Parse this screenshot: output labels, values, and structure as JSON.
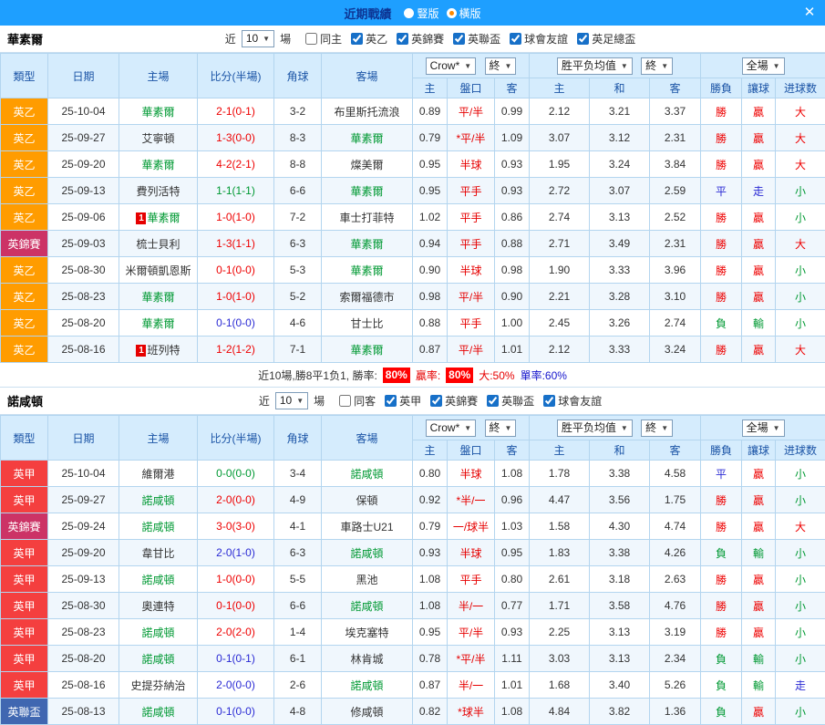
{
  "titlebar": {
    "title": "近期戰績",
    "radio_vertical": "豎版",
    "radio_horizontal": "橫版",
    "close_icon": "✕"
  },
  "table_header": {
    "type": "類型",
    "date": "日期",
    "home": "主場",
    "score": "比分(半場)",
    "corners": "角球",
    "away": "客場",
    "odds_source": "Crow*",
    "final": "終",
    "avg": "胜平负均值",
    "full_match": "全場",
    "home_odds": "主",
    "handicap": "盤口",
    "away_odds": "客",
    "avg_home": "主",
    "avg_draw": "和",
    "avg_away": "客",
    "win_loss": "勝負",
    "give_ball": "讓球",
    "goals": "进球数"
  },
  "colors": {
    "titlebar_bg": "#1E9FFF",
    "league": {
      "英乙": "#FF9C00",
      "英甲": "#F43F3F",
      "英錦賽": "#CC3366",
      "英聯盃": "#4067B1"
    },
    "result": {
      "win": "#EE0000",
      "draw": "#009933",
      "loss": "#2A2AD4"
    },
    "outcome": {
      "勝": "#EE0000",
      "平": "#2A2AD4",
      "負": "#009933",
      "贏": "#EE0000",
      "走": "#2A2AD4",
      "輸": "#009933",
      "大": "#EE0000",
      "小": "#009933"
    },
    "focal_team": "#009933",
    "handicap_text": "#E60000"
  },
  "sections": [
    {
      "team": "華素爾",
      "near_label": "近",
      "count": "10",
      "games_label": "場",
      "filters": [
        {
          "label": "同主",
          "checked": false
        },
        {
          "label": "英乙",
          "checked": true
        },
        {
          "label": "英錦賽",
          "checked": true
        },
        {
          "label": "英聯盃",
          "checked": true
        },
        {
          "label": "球會友誼",
          "checked": true
        },
        {
          "label": "英足總盃",
          "checked": true
        }
      ],
      "rows": [
        {
          "league": "英乙",
          "date": "25-10-04",
          "home": "華素爾",
          "home_focal": true,
          "away": "布里斯托流浪",
          "away_focal": false,
          "score": "2-1(0-1)",
          "result": "win",
          "corners": "3-2",
          "odds_h": "0.89",
          "handicap": "平/半",
          "odds_a": "0.99",
          "avg_h": "2.12",
          "avg_d": "3.21",
          "avg_a": "3.37",
          "wl": "勝",
          "give": "贏",
          "goals": "大"
        },
        {
          "league": "英乙",
          "date": "25-09-27",
          "home": "艾寧頓",
          "home_focal": false,
          "away": "華素爾",
          "away_focal": true,
          "score": "1-3(0-0)",
          "result": "win",
          "corners": "8-3",
          "odds_h": "0.79",
          "handicap": "*平/半",
          "odds_a": "1.09",
          "avg_h": "3.07",
          "avg_d": "3.12",
          "avg_a": "2.31",
          "wl": "勝",
          "give": "贏",
          "goals": "大"
        },
        {
          "league": "英乙",
          "date": "25-09-20",
          "home": "華素爾",
          "home_focal": true,
          "away": "燦美爾",
          "away_focal": false,
          "score": "4-2(2-1)",
          "result": "win",
          "corners": "8-8",
          "odds_h": "0.95",
          "handicap": "半球",
          "odds_a": "0.93",
          "avg_h": "1.95",
          "avg_d": "3.24",
          "avg_a": "3.84",
          "wl": "勝",
          "give": "贏",
          "goals": "大"
        },
        {
          "league": "英乙",
          "date": "25-09-13",
          "home": "費列活特",
          "home_focal": false,
          "away": "華素爾",
          "away_focal": true,
          "score": "1-1(1-1)",
          "result": "draw",
          "corners": "6-6",
          "odds_h": "0.95",
          "handicap": "平手",
          "odds_a": "0.93",
          "avg_h": "2.72",
          "avg_d": "3.07",
          "avg_a": "2.59",
          "wl": "平",
          "give": "走",
          "goals": "小"
        },
        {
          "league": "英乙",
          "date": "25-09-06",
          "home": "華素爾",
          "home_focal": true,
          "home_badge": "1",
          "away": "車士打菲特",
          "away_focal": false,
          "score": "1-0(1-0)",
          "result": "win",
          "corners": "7-2",
          "odds_h": "1.02",
          "handicap": "平手",
          "odds_a": "0.86",
          "avg_h": "2.74",
          "avg_d": "3.13",
          "avg_a": "2.52",
          "wl": "勝",
          "give": "贏",
          "goals": "小"
        },
        {
          "league": "英錦賽",
          "date": "25-09-03",
          "home": "梳士貝利",
          "home_focal": false,
          "away": "華素爾",
          "away_focal": true,
          "score": "1-3(1-1)",
          "result": "win",
          "corners": "6-3",
          "odds_h": "0.94",
          "handicap": "平手",
          "odds_a": "0.88",
          "avg_h": "2.71",
          "avg_d": "3.49",
          "avg_a": "2.31",
          "wl": "勝",
          "give": "贏",
          "goals": "大"
        },
        {
          "league": "英乙",
          "date": "25-08-30",
          "home": "米爾頓凱恩斯",
          "home_focal": false,
          "away": "華素爾",
          "away_focal": true,
          "score": "0-1(0-0)",
          "result": "win",
          "corners": "5-3",
          "odds_h": "0.90",
          "handicap": "半球",
          "odds_a": "0.98",
          "avg_h": "1.90",
          "avg_d": "3.33",
          "avg_a": "3.96",
          "wl": "勝",
          "give": "贏",
          "goals": "小"
        },
        {
          "league": "英乙",
          "date": "25-08-23",
          "home": "華素爾",
          "home_focal": true,
          "away": "索爾福德市",
          "away_focal": false,
          "score": "1-0(1-0)",
          "result": "win",
          "corners": "5-2",
          "odds_h": "0.98",
          "handicap": "平/半",
          "odds_a": "0.90",
          "avg_h": "2.21",
          "avg_d": "3.28",
          "avg_a": "3.10",
          "wl": "勝",
          "give": "贏",
          "goals": "小"
        },
        {
          "league": "英乙",
          "date": "25-08-20",
          "home": "華素爾",
          "home_focal": true,
          "away": "甘士比",
          "away_focal": false,
          "score": "0-1(0-0)",
          "result": "loss",
          "corners": "4-6",
          "odds_h": "0.88",
          "handicap": "平手",
          "odds_a": "1.00",
          "avg_h": "2.45",
          "avg_d": "3.26",
          "avg_a": "2.74",
          "wl": "負",
          "give": "輸",
          "goals": "小"
        },
        {
          "league": "英乙",
          "date": "25-08-16",
          "home": "班列特",
          "home_focal": false,
          "home_badge": "1",
          "away": "華素爾",
          "away_focal": true,
          "score": "1-2(1-2)",
          "result": "win",
          "corners": "7-1",
          "odds_h": "0.87",
          "handicap": "平/半",
          "odds_a": "1.01",
          "avg_h": "2.12",
          "avg_d": "3.33",
          "avg_a": "3.24",
          "wl": "勝",
          "give": "贏",
          "goals": "大"
        }
      ],
      "summary": {
        "prefix": "近10場,勝8平1负1, 勝率:",
        "win_rate": "80%",
        "give_label": "贏率:",
        "give_rate": "80%",
        "big": "大:50%",
        "single": "單率:60%"
      }
    },
    {
      "team": "諾咸頓",
      "near_label": "近",
      "count": "10",
      "games_label": "場",
      "filters": [
        {
          "label": "同客",
          "checked": false
        },
        {
          "label": "英甲",
          "checked": true
        },
        {
          "label": "英錦賽",
          "checked": true
        },
        {
          "label": "英聯盃",
          "checked": true
        },
        {
          "label": "球會友誼",
          "checked": true
        }
      ],
      "rows": [
        {
          "league": "英甲",
          "date": "25-10-04",
          "home": "維爾港",
          "home_focal": false,
          "away": "諾咸頓",
          "away_focal": true,
          "score": "0-0(0-0)",
          "result": "draw",
          "corners": "3-4",
          "odds_h": "0.80",
          "handicap": "半球",
          "odds_a": "1.08",
          "avg_h": "1.78",
          "avg_d": "3.38",
          "avg_a": "4.58",
          "wl": "平",
          "give": "贏",
          "goals": "小"
        },
        {
          "league": "英甲",
          "date": "25-09-27",
          "home": "諾咸頓",
          "home_focal": true,
          "away": "保頓",
          "away_focal": false,
          "score": "2-0(0-0)",
          "result": "win",
          "corners": "4-9",
          "odds_h": "0.92",
          "handicap": "*半/一",
          "odds_a": "0.96",
          "avg_h": "4.47",
          "avg_d": "3.56",
          "avg_a": "1.75",
          "wl": "勝",
          "give": "贏",
          "goals": "小"
        },
        {
          "league": "英錦賽",
          "date": "25-09-24",
          "home": "諾咸頓",
          "home_focal": true,
          "away": "車路士U21",
          "away_focal": false,
          "score": "3-0(3-0)",
          "result": "win",
          "corners": "4-1",
          "odds_h": "0.79",
          "handicap": "一/球半",
          "odds_a": "1.03",
          "avg_h": "1.58",
          "avg_d": "4.30",
          "avg_a": "4.74",
          "wl": "勝",
          "give": "贏",
          "goals": "大"
        },
        {
          "league": "英甲",
          "date": "25-09-20",
          "home": "韋甘比",
          "home_focal": false,
          "away": "諾咸頓",
          "away_focal": true,
          "score": "2-0(1-0)",
          "result": "loss",
          "corners": "6-3",
          "odds_h": "0.93",
          "handicap": "半球",
          "odds_a": "0.95",
          "avg_h": "1.83",
          "avg_d": "3.38",
          "avg_a": "4.26",
          "wl": "負",
          "give": "輸",
          "goals": "小"
        },
        {
          "league": "英甲",
          "date": "25-09-13",
          "home": "諾咸頓",
          "home_focal": true,
          "away": "黑池",
          "away_focal": false,
          "score": "1-0(0-0)",
          "result": "win",
          "corners": "5-5",
          "odds_h": "1.08",
          "handicap": "平手",
          "odds_a": "0.80",
          "avg_h": "2.61",
          "avg_d": "3.18",
          "avg_a": "2.63",
          "wl": "勝",
          "give": "贏",
          "goals": "小"
        },
        {
          "league": "英甲",
          "date": "25-08-30",
          "home": "奧連特",
          "home_focal": false,
          "away": "諾咸頓",
          "away_focal": true,
          "score": "0-1(0-0)",
          "result": "win",
          "corners": "6-6",
          "odds_h": "1.08",
          "handicap": "半/一",
          "odds_a": "0.77",
          "avg_h": "1.71",
          "avg_d": "3.58",
          "avg_a": "4.76",
          "wl": "勝",
          "give": "贏",
          "goals": "小"
        },
        {
          "league": "英甲",
          "date": "25-08-23",
          "home": "諾咸頓",
          "home_focal": true,
          "away": "埃克塞特",
          "away_focal": false,
          "score": "2-0(2-0)",
          "result": "win",
          "corners": "1-4",
          "odds_h": "0.95",
          "handicap": "平/半",
          "odds_a": "0.93",
          "avg_h": "2.25",
          "avg_d": "3.13",
          "avg_a": "3.19",
          "wl": "勝",
          "give": "贏",
          "goals": "小"
        },
        {
          "league": "英甲",
          "date": "25-08-20",
          "home": "諾咸頓",
          "home_focal": true,
          "away": "林肯城",
          "away_focal": false,
          "score": "0-1(0-1)",
          "result": "loss",
          "corners": "6-1",
          "odds_h": "0.78",
          "handicap": "*平/半",
          "odds_a": "1.11",
          "avg_h": "3.03",
          "avg_d": "3.13",
          "avg_a": "2.34",
          "wl": "負",
          "give": "輸",
          "goals": "小"
        },
        {
          "league": "英甲",
          "date": "25-08-16",
          "home": "史提芬納治",
          "home_focal": false,
          "away": "諾咸頓",
          "away_focal": true,
          "score": "2-0(0-0)",
          "result": "loss",
          "corners": "2-6",
          "odds_h": "0.87",
          "handicap": "半/一",
          "odds_a": "1.01",
          "avg_h": "1.68",
          "avg_d": "3.40",
          "avg_a": "5.26",
          "wl": "負",
          "give": "輸",
          "goals": "走"
        },
        {
          "league": "英聯盃",
          "date": "25-08-13",
          "home": "諾咸頓",
          "home_focal": true,
          "away": "修咸頓",
          "away_focal": false,
          "score": "0-1(0-0)",
          "result": "loss",
          "corners": "4-8",
          "odds_h": "0.82",
          "handicap": "*球半",
          "odds_a": "1.08",
          "avg_h": "4.84",
          "avg_d": "3.82",
          "avg_a": "1.36",
          "wl": "負",
          "give": "贏",
          "goals": "小"
        }
      ]
    }
  ]
}
